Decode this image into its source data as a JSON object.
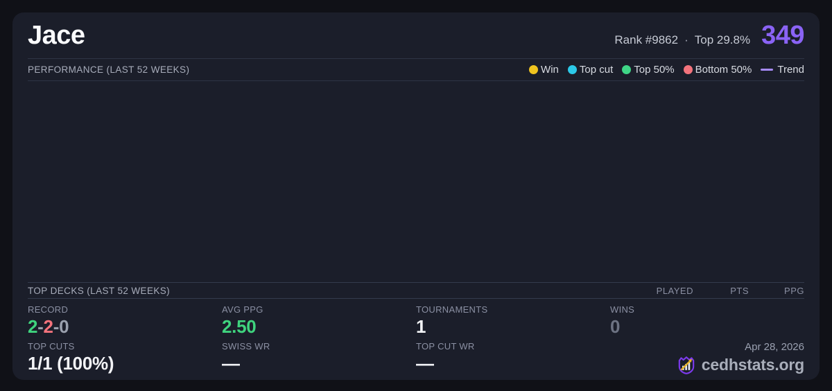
{
  "header": {
    "title": "Jace",
    "rank_text": "Rank #9862",
    "separator": "·",
    "top_percent": "Top 29.8%",
    "score": "349",
    "score_color": "#8a63f5"
  },
  "performance": {
    "section_title": "PERFORMANCE (LAST 52 WEEKS)",
    "legend": [
      {
        "label": "Win",
        "color": "#f0c41f",
        "type": "dot"
      },
      {
        "label": "Top cut",
        "color": "#2cc9e8",
        "type": "dot"
      },
      {
        "label": "Top 50%",
        "color": "#3fd586",
        "type": "dot"
      },
      {
        "label": "Bottom 50%",
        "color": "#f3737c",
        "type": "dot"
      },
      {
        "label": "Trend",
        "color": "#a78bfa",
        "type": "line"
      }
    ],
    "chart_empty": true
  },
  "top_decks": {
    "section_title": "TOP DECKS (LAST 52 WEEKS)",
    "columns": [
      "PLAYED",
      "PTS",
      "PPG"
    ],
    "rows": []
  },
  "stats": {
    "record": {
      "label": "RECORD",
      "wins": "2",
      "sep1": "-",
      "losses": "2",
      "sep2": "-",
      "draws": "0",
      "wins_color": "#3fd47e",
      "losses_color": "#f3737c",
      "draws_color": "#9aa0ad",
      "sep_color": "#9aa0ad"
    },
    "avg_ppg": {
      "label": "AVG PPG",
      "value": "2.50",
      "color": "#3fd47e"
    },
    "tournaments": {
      "label": "TOURNAMENTS",
      "value": "1",
      "color": "#f2f3f6"
    },
    "wins": {
      "label": "WINS",
      "value": "0",
      "color": "#6d7383"
    },
    "top_cuts": {
      "label": "TOP CUTS",
      "value": "1/1 (100%)",
      "color": "#f2f3f6"
    },
    "swiss_wr": {
      "label": "SWISS WR",
      "value": "—",
      "color": "#f2f3f6"
    },
    "top_cut_wr": {
      "label": "TOP CUT WR",
      "value": "—",
      "color": "#f2f3f6"
    }
  },
  "footer": {
    "date": "Apr 28, 2026",
    "brand": "cedhstats.org",
    "logo": {
      "shield_color": "#7c3aed",
      "bars_color": "#e9ebf2",
      "arrow_color": "#e8b427"
    }
  }
}
